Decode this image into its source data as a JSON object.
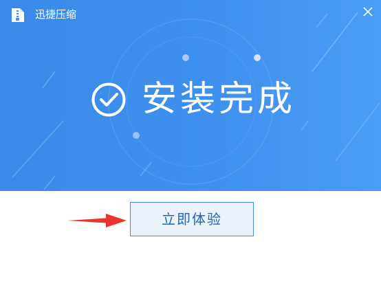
{
  "window": {
    "title": "迅捷压缩",
    "logo_icon": "zip-file-icon",
    "close_icon": "close-icon"
  },
  "banner": {
    "headline": "安装完成",
    "check_icon": "check-circle-icon",
    "background_color": "#3f90ee"
  },
  "actions": {
    "start_label": "立即体验",
    "pointer_icon": "red-arrow-icon",
    "arrow_color": "#e8352e"
  }
}
